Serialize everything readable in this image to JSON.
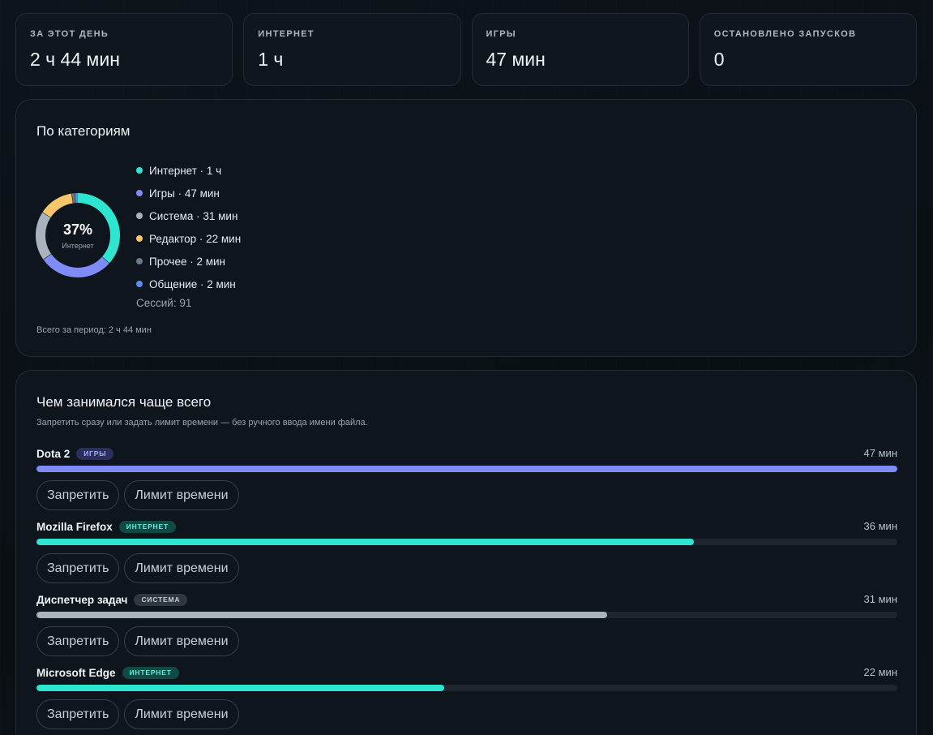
{
  "stats": [
    {
      "label": "ЗА ЭТОТ ДЕНЬ",
      "value": "2 ч 44 мин"
    },
    {
      "label": "ИНТЕРНЕТ",
      "value": "1 ч"
    },
    {
      "label": "ИГРЫ",
      "value": "47 мин"
    },
    {
      "label": "ОСТАНОВЛЕНО ЗАПУСКОВ",
      "value": "0"
    }
  ],
  "categories_panel": {
    "title": "По категориям",
    "donut": {
      "percent_label": "37%",
      "center_label": "Интернет",
      "segments": [
        {
          "name": "Интернет",
          "minutes": 60,
          "color": "#2ee6cf"
        },
        {
          "name": "Игры",
          "minutes": 47,
          "color": "#7f8cf7"
        },
        {
          "name": "Система",
          "minutes": 31,
          "color": "#a9b3bd"
        },
        {
          "name": "Редактор",
          "minutes": 22,
          "color": "#f7c56a"
        },
        {
          "name": "Прочее",
          "minutes": 2,
          "color": "#6c7886"
        },
        {
          "name": "Общение",
          "minutes": 2,
          "color": "#5b8cf0"
        }
      ]
    },
    "legend": [
      {
        "text": "Интернет · 1 ч",
        "color": "#2ee6cf"
      },
      {
        "text": "Игры · 47 мин",
        "color": "#7f8cf7"
      },
      {
        "text": "Система · 31 мин",
        "color": "#a9b3bd"
      },
      {
        "text": "Редактор · 22 мин",
        "color": "#f7c56a"
      },
      {
        "text": "Прочее · 2 мин",
        "color": "#6c7886"
      },
      {
        "text": "Общение · 2 мин",
        "color": "#5b8cf0"
      }
    ],
    "sessions": "Сессий: 91",
    "period_total": "Всего за период: 2 ч 44 мин"
  },
  "top_panel": {
    "title": "Чем занимался чаще всего",
    "subtitle": "Запретить сразу или задать лимит времени — без ручного ввода имени файла.",
    "ban_label": "Запретить",
    "limit_label": "Лимит времени",
    "apps": [
      {
        "name": "Dota 2",
        "badge": "ИГРЫ",
        "badge_bg": "#2a2f5c",
        "badge_fg": "#a5adff",
        "time": "47 мин",
        "fraction": 1.0,
        "color": "#7f8cf7"
      },
      {
        "name": "Mozilla Firefox",
        "badge": "ИНТЕРНЕТ",
        "badge_bg": "#0f4a45",
        "badge_fg": "#5ff0dc",
        "time": "36 мин",
        "fraction": 0.764,
        "color": "#2ee6cf"
      },
      {
        "name": "Диспетчер задач",
        "badge": "СИСТЕМА",
        "badge_bg": "#2f3740",
        "badge_fg": "#c4ccd4",
        "time": "31 мин",
        "fraction": 0.663,
        "color": "#a9b3bd"
      },
      {
        "name": "Microsoft Edge",
        "badge": "ИНТЕРНЕТ",
        "badge_bg": "#0f4a45",
        "badge_fg": "#5ff0dc",
        "time": "22 мин",
        "fraction": 0.474,
        "color": "#2ee6cf"
      }
    ]
  }
}
